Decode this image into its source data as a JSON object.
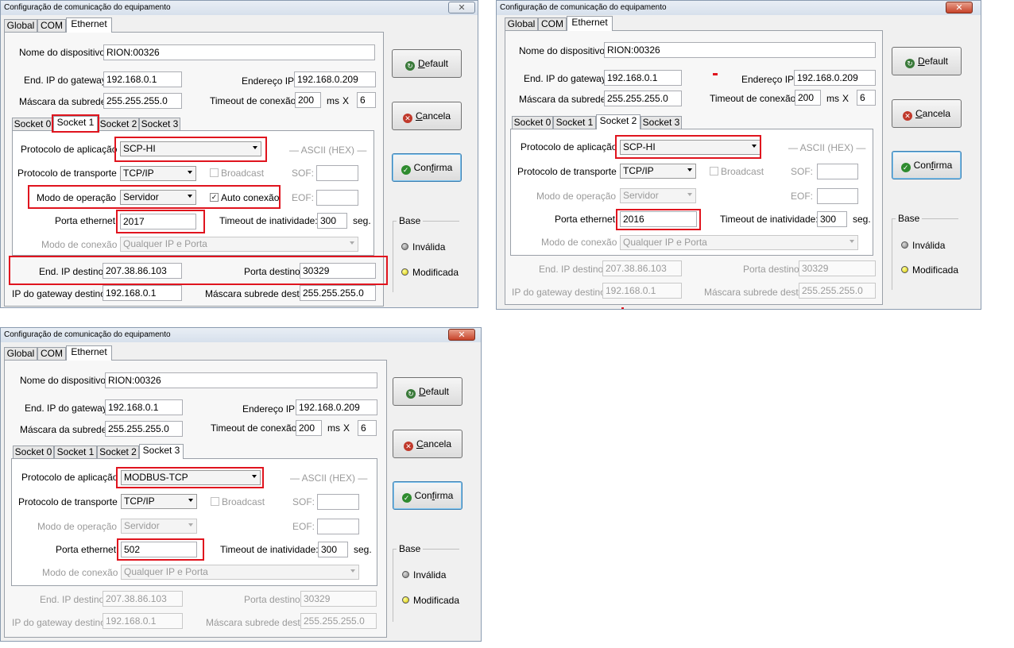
{
  "window_title": "Configuração de comunicação do equipamento",
  "close_glyph": "✕",
  "main_tabs": [
    "Global",
    "COM",
    "Ethernet"
  ],
  "socket_tabs": [
    "Socket 0",
    "Socket 1",
    "Socket 2",
    "Socket 3"
  ],
  "labels": {
    "device_name": "Nome do dispositivo",
    "gateway_ip": "End. IP do gateway",
    "ip_address": "Endereço IP",
    "subnet_mask": "Máscara da subrede",
    "conn_timeout": "Timeout de conexão",
    "ms": "ms",
    "x": "X",
    "app_protocol": "Protocolo de aplicação",
    "ascii_hex": "— ASCII (HEX) —",
    "transport_protocol": "Protocolo de transporte",
    "broadcast": "Broadcast",
    "sof": "SOF:",
    "op_mode": "Modo de operação",
    "auto_conn": "Auto conexão",
    "eof": "EOF:",
    "eth_port": "Porta ethernet",
    "inactivity_timeout": "Timeout de inatividade:",
    "seg": "seg.",
    "conn_mode": "Modo de conexão",
    "dest_ip": "End. IP destino",
    "dest_port": "Porta destino",
    "dest_gateway": "IP do gateway destino",
    "dest_mask": "Máscara subrede dest."
  },
  "buttons": {
    "default_first": "D",
    "default_rest": "efault",
    "cancel_first": "C",
    "cancel_rest": "ancela",
    "confirm_pre": "Con",
    "confirm_ul": "f",
    "confirm_post": "irma"
  },
  "base_group": {
    "title": "Base",
    "invalid": "Inválida",
    "modified": "Modificada"
  },
  "values": {
    "device_name": "RION:00326",
    "gateway_ip": "192.168.0.1",
    "ip_address": "192.168.0.209",
    "subnet_mask": "255.255.255.0",
    "conn_timeout": "200",
    "retries": "6",
    "transport": "TCP/IP",
    "op_mode": "Servidor",
    "inactivity": "300",
    "conn_mode": "Qualquer IP e Porta",
    "dest_ip": "207.38.86.103",
    "dest_port": "30329",
    "dest_gateway": "192.168.0.1",
    "dest_mask": "255.255.255.0"
  },
  "dialogs": [
    {
      "active_socket_tab": "Socket 1",
      "app_protocol": "SCP-HI",
      "eth_port": "2017"
    },
    {
      "active_socket_tab": "Socket 2",
      "app_protocol": "SCP-HI",
      "eth_port": "2016"
    },
    {
      "active_socket_tab": "Socket 3",
      "app_protocol": "MODBUS-TCP",
      "eth_port": "502"
    }
  ],
  "colors": {
    "highlight": "#e0141e",
    "titlebar": "#d7e0ec"
  }
}
